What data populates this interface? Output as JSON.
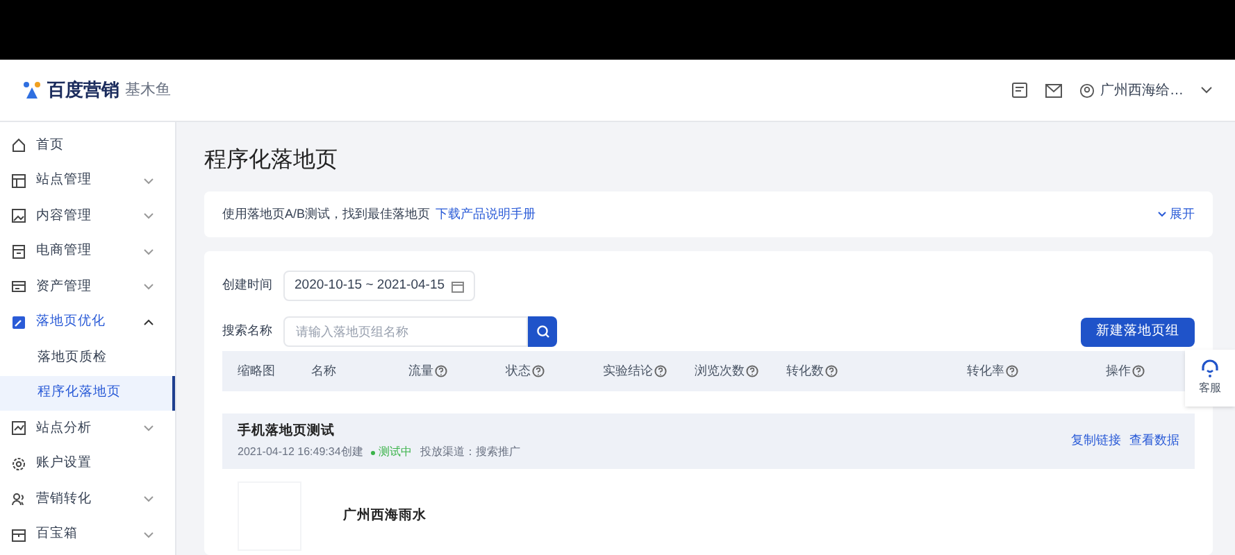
{
  "header": {
    "logo": "百度营销",
    "product": "基木鱼",
    "account": "广州西海给…"
  },
  "sidebar": {
    "items": [
      {
        "label": "首页"
      },
      {
        "label": "站点管理",
        "expanded": false
      },
      {
        "label": "内容管理",
        "expanded": false
      },
      {
        "label": "电商管理",
        "expanded": false
      },
      {
        "label": "资产管理",
        "expanded": false
      },
      {
        "label": "落地页优化",
        "expanded": true,
        "children": [
          {
            "label": "落地页质检",
            "selected": false
          },
          {
            "label": "程序化落地页",
            "selected": true
          }
        ]
      },
      {
        "label": "站点分析",
        "expanded": false
      },
      {
        "label": "账户设置"
      },
      {
        "label": "营销转化",
        "expanded": false
      },
      {
        "label": "百宝箱",
        "expanded": false
      }
    ]
  },
  "page_title": "程序化落地页",
  "notice": {
    "text": "使用落地页A/B测试，找到最佳落地页",
    "link": "下载产品说明手册",
    "toggle": "展开"
  },
  "filters": {
    "date_label": "创建时间",
    "date_range": "2020-10-15 ~ 2021-04-15",
    "search_label": "搜索名称",
    "search_placeholder": "请输入落地页组名称"
  },
  "new_button": "新建落地页组",
  "table": {
    "columns": [
      "缩略图",
      "名称",
      "流量",
      "状态",
      "实验结论",
      "浏览次数",
      "转化数",
      "转化率",
      "操作"
    ],
    "groups": [
      {
        "name": "手机落地页测试",
        "created": "2021-04-12 16:49:34创建",
        "status": "测试中",
        "channel": "投放渠道：搜索推广",
        "actions": [
          "复制链接",
          "查看数据"
        ],
        "rows": [
          {
            "name": "广州西海雨水"
          }
        ]
      }
    ]
  },
  "help_widget": {
    "label": "客服"
  }
}
